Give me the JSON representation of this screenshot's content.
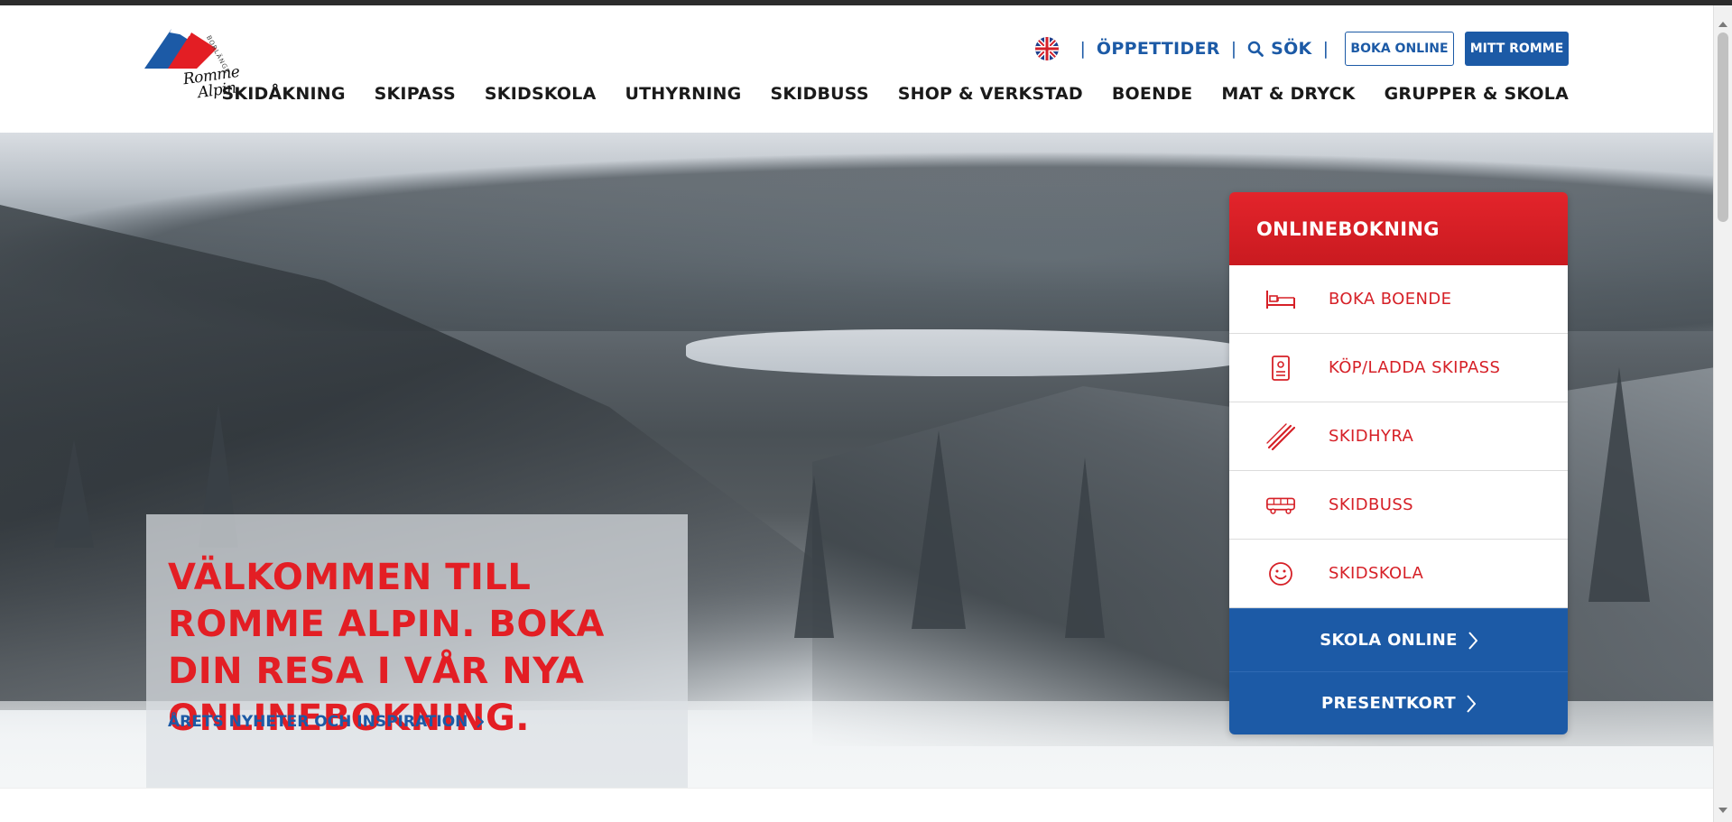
{
  "brand": {
    "logo_line1": "Romme",
    "logo_line2": "Alpin",
    "logo_small": "BORLÄNGE"
  },
  "utility_nav": {
    "language_flag": "uk-flag-icon",
    "opening_hours": "ÖPPETTIDER",
    "search": "SÖK",
    "book_online": "BOKA ONLINE",
    "my_romme": "MITT ROMME"
  },
  "main_nav": [
    "SKIDÅKNING",
    "SKIPASS",
    "SKIDSKOLA",
    "UTHYRNING",
    "SKIDBUSS",
    "SHOP & VERKSTAD",
    "BOENDE",
    "MAT & DRYCK",
    "GRUPPER & SKOLA"
  ],
  "hero": {
    "headline": "VÄLKOMMEN TILL ROMME ALPIN. BOKA DIN RESA I VÅR NYA ONLINEBOKNING.",
    "link": "ÅRETS NYHETER OCH INSPIRATION"
  },
  "booking": {
    "title": "ONLINEBOKNING",
    "items": [
      {
        "label": "BOKA BOENDE",
        "icon": "bed-icon"
      },
      {
        "label": "KÖP/LADDA SKIPASS",
        "icon": "skipass-card-icon"
      },
      {
        "label": "SKIDHYRA",
        "icon": "skis-icon"
      },
      {
        "label": "SKIDBUSS",
        "icon": "bus-icon"
      },
      {
        "label": "SKIDSKOLA",
        "icon": "smiley-icon"
      }
    ],
    "school_online": "SKOLA ONLINE",
    "gift_card": "PRESENTKORT"
  },
  "colors": {
    "brand_red": "#e31e24",
    "brand_blue": "#1c5aa6",
    "text_dark": "#1a1a1a"
  }
}
